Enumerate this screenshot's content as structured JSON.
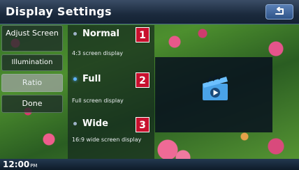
{
  "header": {
    "title": "Display Settings"
  },
  "menu": {
    "adjust_screen": "Adjust Screen",
    "illumination": "Illumination",
    "ratio": "Ratio",
    "done": "Done"
  },
  "options": [
    {
      "label": "Normal",
      "desc": "4:3 screen display",
      "badge": "1",
      "selected": false
    },
    {
      "label": "Full",
      "desc": "Full screen display",
      "badge": "2",
      "selected": true
    },
    {
      "label": "Wide",
      "desc": "16:9 wide screen display",
      "badge": "3",
      "selected": false
    }
  ],
  "status": {
    "time": "12:00",
    "ampm": "PM"
  },
  "colors": {
    "accent": "#5fb3ff",
    "badge": "#c8102e",
    "title_bar": "#1b2a3d"
  },
  "icons": {
    "back": "back-arrow-icon",
    "preview": "video-clapper-icon"
  }
}
